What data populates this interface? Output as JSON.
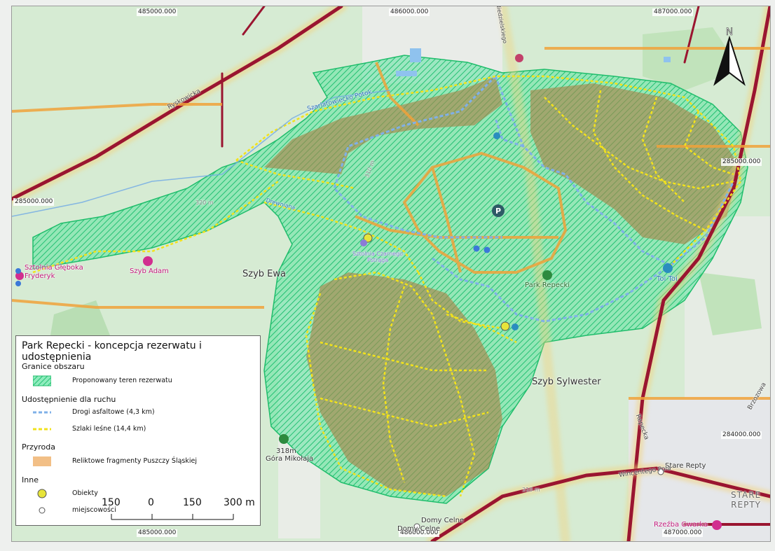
{
  "coords": {
    "top": [
      "485000.000",
      "486000.000",
      "487000.000"
    ],
    "bottom": [
      "485000.000",
      "486000.000",
      "487000.000"
    ],
    "left": [
      "285000.000"
    ],
    "right": [
      "285000.000",
      "284000.000"
    ]
  },
  "places": {
    "szyb_ewa": "Szyb Ewa",
    "szyb_sylwester": "Szyb Sylwester",
    "stare_repty_village": "Stare Repty",
    "stare_repty_district": "STARE\nREPTY",
    "domy_celne": "Domy Celne",
    "domy_celne_short": "Domy Celne",
    "gora_mikolaja": "Góra Mikołaja",
    "gora_height": "318m"
  },
  "pois": {
    "sztolnia": "Sztolnia Głęboka\nFryderyk",
    "szyb_adam": "Szyb Adam",
    "rzezba_gwarka": "Rzeźba Gwarka",
    "toi_toi": "Toi Toi",
    "park_repecki": "Park Repecki",
    "sztolnia_czarnego_pstraga": "Sztolnia Czarnego\nPstrąga",
    "drewniana": "Drewniana",
    "potok": "Szarlatowiecko Potok"
  },
  "streets": {
    "ryskowicka": "Ryskowicka",
    "repecka": "Repecka",
    "wincentego": "Wincentego Pola",
    "brzozowa": "Brzozowa",
    "niedzielskiego": "Niedzielskiego",
    "contour_310_a": "310 m",
    "contour_310_b": "310 m",
    "contour_320": "320 m"
  },
  "legend": {
    "title": "Park Repecki - koncepcja rezerwatu i udostępnienia",
    "sections": [
      {
        "title": "Granice obszaru",
        "items": [
          {
            "label": "Proponowany teren rezerwatu"
          }
        ]
      },
      {
        "title": "Udostępnienie dla ruchu",
        "items": [
          {
            "label": "Drogi asfaltowe (4,3 km)"
          },
          {
            "label": "Szlaki leśne (14,4 km)"
          }
        ]
      },
      {
        "title": "Przyroda",
        "items": [
          {
            "label": "Reliktowe fragmenty Puszczy Śląskiej"
          }
        ]
      },
      {
        "title": "Inne",
        "items": [
          {
            "label": "Obiekty"
          },
          {
            "label": "miejscowości"
          }
        ]
      }
    ],
    "scale": {
      "labels": [
        "150",
        "0",
        "150",
        "300 m"
      ]
    }
  },
  "north_label": "N",
  "colors": {
    "reserve_fill": "#37d98a",
    "relict_fill": "#a8854a",
    "asphalt": "#7fb0e8",
    "trail": "#f2e21c",
    "major_road": "#9a1530",
    "minor_road": "#f2a43c"
  }
}
